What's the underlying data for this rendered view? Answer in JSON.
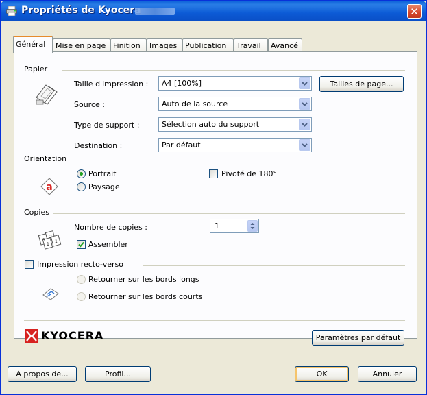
{
  "window": {
    "title": "Propriétés de Kyocera"
  },
  "tabs": [
    "Général",
    "Mise en page",
    "Finition",
    "Images",
    "Publication",
    "Travail",
    "Avancé"
  ],
  "paper": {
    "group_label": "Papier",
    "size_label": "Taille d'impression :",
    "size_value": "A4  [100%]",
    "source_label": "Source :",
    "source_value": "Auto de la source",
    "media_label": "Type de support :",
    "media_value": "Sélection auto du support",
    "dest_label": "Destination :",
    "dest_value": "Par défaut",
    "page_sizes_button": "Tailles de page..."
  },
  "orientation": {
    "group_label": "Orientation",
    "portrait": "Portrait",
    "landscape": "Paysage",
    "rotate": "Pivoté de 180°"
  },
  "copies": {
    "group_label": "Copies",
    "count_label": "Nombre de copies :",
    "count_value": "1",
    "collate": "Assembler"
  },
  "duplex": {
    "label": "Impression recto-verso",
    "long_edge": "Retourner sur les bords longs",
    "short_edge": "Retourner sur les bords courts"
  },
  "brand": {
    "logo_text": "KYOCERA"
  },
  "buttons": {
    "defaults": "Paramètres par défaut",
    "about": "À propos de...",
    "profile": "Profil...",
    "ok": "OK",
    "cancel": "Annuler"
  },
  "colors": {
    "accent": "#0a5fd8",
    "tab_highlight": "#e68b2c",
    "logo_red": "#d7211f"
  }
}
